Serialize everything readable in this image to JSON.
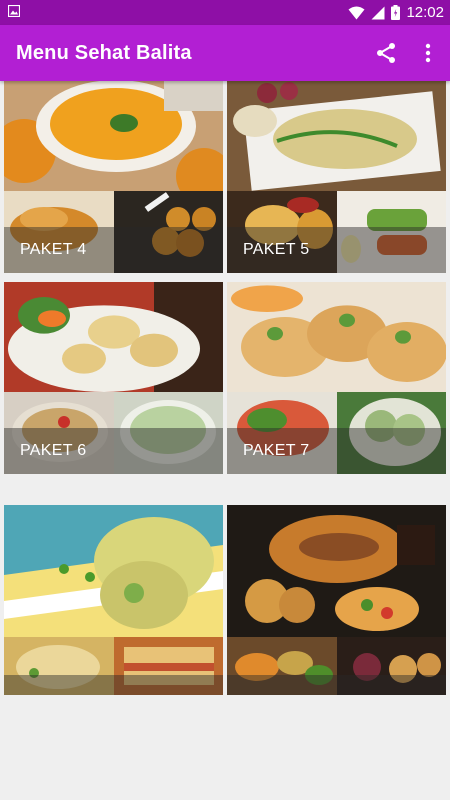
{
  "status_bar": {
    "time": "12:02",
    "icons": [
      "image-notification-icon",
      "wifi-icon",
      "signal-icon",
      "battery-icon"
    ]
  },
  "app_bar": {
    "title": "Menu Sehat Balita",
    "actions": [
      "share-icon",
      "more-vert-icon"
    ]
  },
  "colors": {
    "status_bar": "#8e0fa6",
    "app_bar": "#b21fd3",
    "background": "#efefef"
  },
  "packages": [
    {
      "label": "PAKET 4"
    },
    {
      "label": "PAKET 5"
    },
    {
      "label": "PAKET 6"
    },
    {
      "label": "PAKET 7"
    },
    {
      "label": ""
    },
    {
      "label": ""
    }
  ]
}
